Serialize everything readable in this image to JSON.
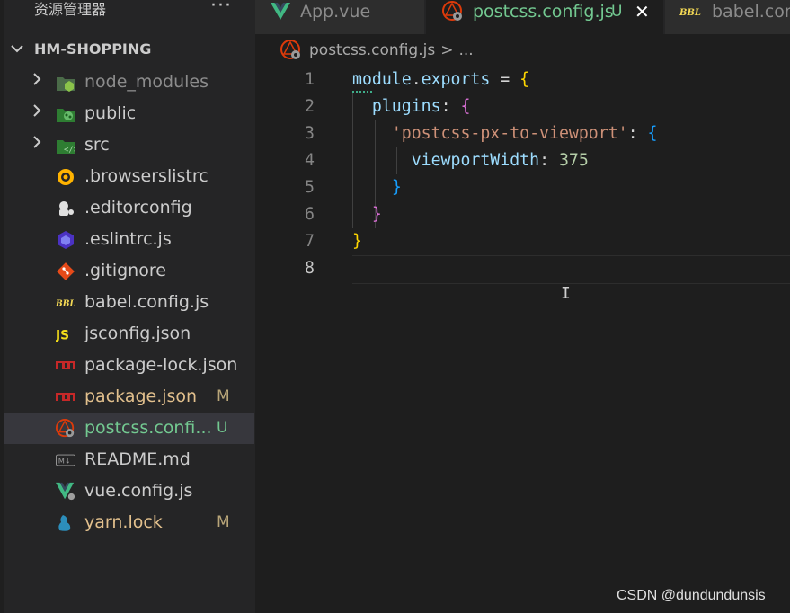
{
  "sidebar": {
    "title": "资源管理器",
    "more": "···",
    "project": "HM-SHOPPING",
    "files": [
      {
        "name": "node_modules",
        "icon": "node-modules-folder-icon",
        "expandable": true,
        "badge": "",
        "state": "dim"
      },
      {
        "name": "public",
        "icon": "public-folder-icon",
        "expandable": true,
        "badge": "",
        "state": "normal"
      },
      {
        "name": "src",
        "icon": "src-folder-icon",
        "expandable": true,
        "badge": "",
        "state": "normal"
      },
      {
        "name": ".browserslistrc",
        "icon": "browserslist-icon",
        "expandable": false,
        "badge": "",
        "state": "normal"
      },
      {
        "name": ".editorconfig",
        "icon": "editorconfig-icon",
        "expandable": false,
        "badge": "",
        "state": "normal"
      },
      {
        "name": ".eslintrc.js",
        "icon": "eslint-icon",
        "expandable": false,
        "badge": "",
        "state": "normal"
      },
      {
        "name": ".gitignore",
        "icon": "git-icon",
        "expandable": false,
        "badge": "",
        "state": "normal"
      },
      {
        "name": "babel.config.js",
        "icon": "babel-icon",
        "expandable": false,
        "badge": "",
        "state": "normal"
      },
      {
        "name": "jsconfig.json",
        "icon": "js-icon",
        "expandable": false,
        "badge": "",
        "state": "normal"
      },
      {
        "name": "package-lock.json",
        "icon": "npm-icon",
        "expandable": false,
        "badge": "",
        "state": "normal"
      },
      {
        "name": "package.json",
        "icon": "npm-icon",
        "expandable": false,
        "badge": "M",
        "state": "modified"
      },
      {
        "name": "postcss.confi...",
        "icon": "postcss-icon",
        "expandable": false,
        "badge": "U",
        "state": "untracked"
      },
      {
        "name": "README.md",
        "icon": "markdown-icon",
        "expandable": false,
        "badge": "",
        "state": "normal"
      },
      {
        "name": "vue.config.js",
        "icon": "vue-config-icon",
        "expandable": false,
        "badge": "",
        "state": "normal"
      },
      {
        "name": "yarn.lock",
        "icon": "yarn-icon",
        "expandable": false,
        "badge": "M",
        "state": "modified"
      }
    ]
  },
  "tabs": [
    {
      "label": "App.vue",
      "badge": "",
      "icon": "vue-icon",
      "active": false
    },
    {
      "label": "postcss.config.js",
      "badge": "U",
      "icon": "postcss-icon",
      "active": true,
      "close": "✕"
    },
    {
      "label": "babel.con",
      "badge": "",
      "icon": "babel-icon",
      "active": false
    }
  ],
  "breadcrumb": {
    "file": "postcss.config.js",
    "separator": ">",
    "more": "..."
  },
  "editor": {
    "line_numbers": [
      "1",
      "2",
      "3",
      "4",
      "5",
      "6",
      "7",
      "8"
    ],
    "current_line": 8,
    "lines": [
      [
        {
          "t": "module",
          "c": "var"
        },
        {
          "t": ".",
          "c": "plain"
        },
        {
          "t": "exports",
          "c": "var"
        },
        {
          "t": " = ",
          "c": "plain"
        },
        {
          "t": "{",
          "c": "b1"
        }
      ],
      [
        {
          "t": "  ",
          "c": "plain"
        },
        {
          "t": "plugins",
          "c": "var"
        },
        {
          "t": ": ",
          "c": "plain"
        },
        {
          "t": "{",
          "c": "b2"
        }
      ],
      [
        {
          "t": "    ",
          "c": "plain"
        },
        {
          "t": "'postcss-px-to-viewport'",
          "c": "str"
        },
        {
          "t": ": ",
          "c": "plain"
        },
        {
          "t": "{",
          "c": "b3"
        }
      ],
      [
        {
          "t": "      ",
          "c": "plain"
        },
        {
          "t": "viewportWidth",
          "c": "var"
        },
        {
          "t": ": ",
          "c": "plain"
        },
        {
          "t": "375",
          "c": "num"
        }
      ],
      [
        {
          "t": "    ",
          "c": "plain"
        },
        {
          "t": "}",
          "c": "b3"
        }
      ],
      [
        {
          "t": "  ",
          "c": "plain"
        },
        {
          "t": "}",
          "c": "b2"
        }
      ],
      [
        {
          "t": "}",
          "c": "b1"
        }
      ],
      []
    ]
  },
  "ibeam": "I",
  "watermark": "CSDN @dundundunsis"
}
